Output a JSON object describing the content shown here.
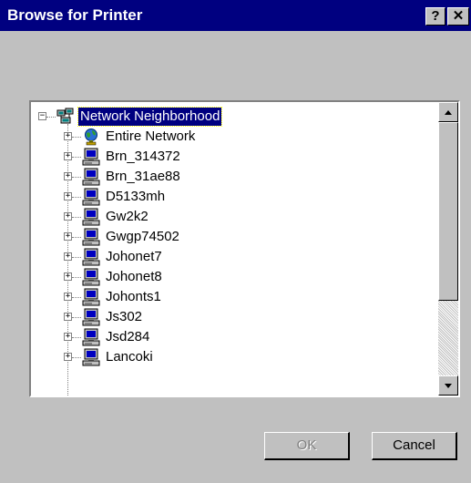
{
  "window": {
    "title": "Browse for Printer",
    "help_label": "?",
    "close_label": "✕"
  },
  "tree": {
    "root": {
      "label": "Network Neighborhood",
      "expander": "−",
      "icon": "network-neighborhood-icon"
    },
    "items": [
      {
        "label": "Entire Network",
        "icon": "globe-icon"
      },
      {
        "label": "Brn_314372",
        "icon": "computer-icon"
      },
      {
        "label": "Brn_31ae88",
        "icon": "computer-icon"
      },
      {
        "label": "D5133mh",
        "icon": "computer-icon"
      },
      {
        "label": "Gw2k2",
        "icon": "computer-icon"
      },
      {
        "label": "Gwgp74502",
        "icon": "computer-icon"
      },
      {
        "label": "Johonet7",
        "icon": "computer-icon"
      },
      {
        "label": "Johonet8",
        "icon": "computer-icon"
      },
      {
        "label": "Johonts1",
        "icon": "computer-icon"
      },
      {
        "label": "Js302",
        "icon": "computer-icon"
      },
      {
        "label": "Jsd284",
        "icon": "computer-icon"
      },
      {
        "label": "Lancoki",
        "icon": "computer-icon"
      }
    ],
    "item_expander": "+"
  },
  "buttons": {
    "ok_label": "OK",
    "cancel_label": "Cancel"
  },
  "colors": {
    "titlebar": "#000080",
    "face": "#c0c0c0",
    "selection": "#000080"
  }
}
